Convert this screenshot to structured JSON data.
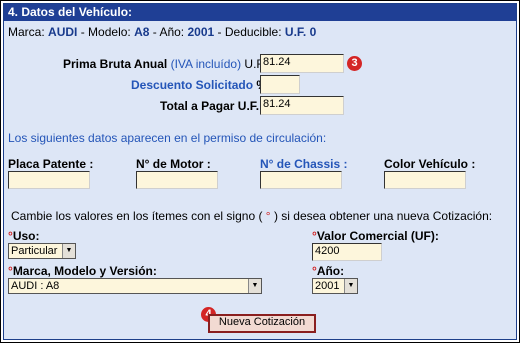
{
  "section_title": "4. Datos del Vehículo:",
  "vehicle_info": {
    "marca_label": "Marca:",
    "marca_value": "AUDI",
    "modelo_label": "- Modelo:",
    "modelo_value": "A8",
    "anio_label": "- Año:",
    "anio_value": "2001",
    "deducible_label": "- Deducible:",
    "deducible_value": "U.F. 0"
  },
  "prima": {
    "label_bold": "Prima Bruta Anual",
    "label_blue": "(IVA incluído)",
    "label_suffix": "U.F.:",
    "value": "81.24",
    "badge": "3"
  },
  "descuento": {
    "label": "Descuento Solicitado",
    "suffix": "%:",
    "value": ""
  },
  "total": {
    "label": "Total a Pagar U.F.:",
    "value": "81.24"
  },
  "permiso_note": "Los siguientes datos aparecen en el permiso de circulación:",
  "fields": {
    "placa": {
      "label": "Placa Patente :",
      "value": ""
    },
    "motor": {
      "label": "N° de Motor :",
      "value": ""
    },
    "chassis": {
      "label": "N° de Chassis :",
      "value": ""
    },
    "color": {
      "label": "Color Vehículo :",
      "value": ""
    }
  },
  "change_note": {
    "part1": "Cambie los valores en los ítemes con el signo (",
    "mark": "°",
    "part2": ") si desea obtener una nueva Cotización:"
  },
  "uso": {
    "mark": "°",
    "label": "Uso:",
    "selected": "Particular"
  },
  "valor_comercial": {
    "mark": "°",
    "label": "Valor Comercial (UF):",
    "value": "4200"
  },
  "marca_modelo": {
    "mark": "°",
    "label": "Marca, Modelo y Versión:",
    "selected": "AUDI : A8"
  },
  "anio": {
    "mark": "°",
    "label": "Año:",
    "selected": "2001"
  },
  "nueva_cotizacion": {
    "label": "Nueva Cotización",
    "badge": "4"
  },
  "colors": {
    "header_bg": "#1f3f95",
    "panel_bg": "#dde6f6",
    "input_bg": "#fdf6dc",
    "badge": "#d42525"
  }
}
